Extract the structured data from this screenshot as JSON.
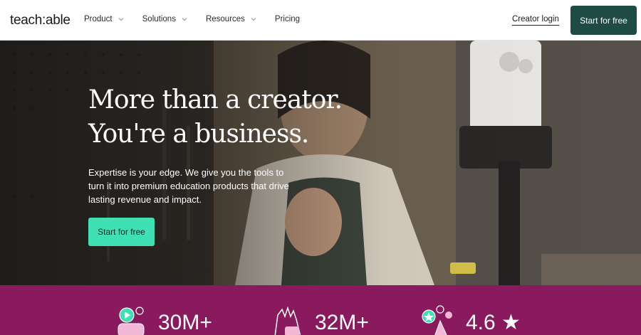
{
  "header": {
    "logo": "teach:able",
    "nav": [
      {
        "label": "Product",
        "has_dropdown": true
      },
      {
        "label": "Solutions",
        "has_dropdown": true
      },
      {
        "label": "Resources",
        "has_dropdown": true
      },
      {
        "label": "Pricing",
        "has_dropdown": false
      }
    ],
    "login_label": "Creator login",
    "cta_label": "Start for free"
  },
  "hero": {
    "title_line1": "More than a creator.",
    "title_line2": "You're a business.",
    "subtitle": "Expertise is your edge. We give you the tools to turn it into premium education products that drive lasting revenue and impact.",
    "cta_label": "Start for free"
  },
  "stats": [
    {
      "value": "30M+",
      "icon": "play-video-icon"
    },
    {
      "value": "32M+",
      "icon": "raised-hands-icon"
    },
    {
      "value": "4.6 ★",
      "icon": "star-badge-icon"
    }
  ],
  "colors": {
    "header_cta_bg": "#1f4b45",
    "hero_cta_bg": "#3fe0b3",
    "stats_bg": "#8a1a5e"
  }
}
